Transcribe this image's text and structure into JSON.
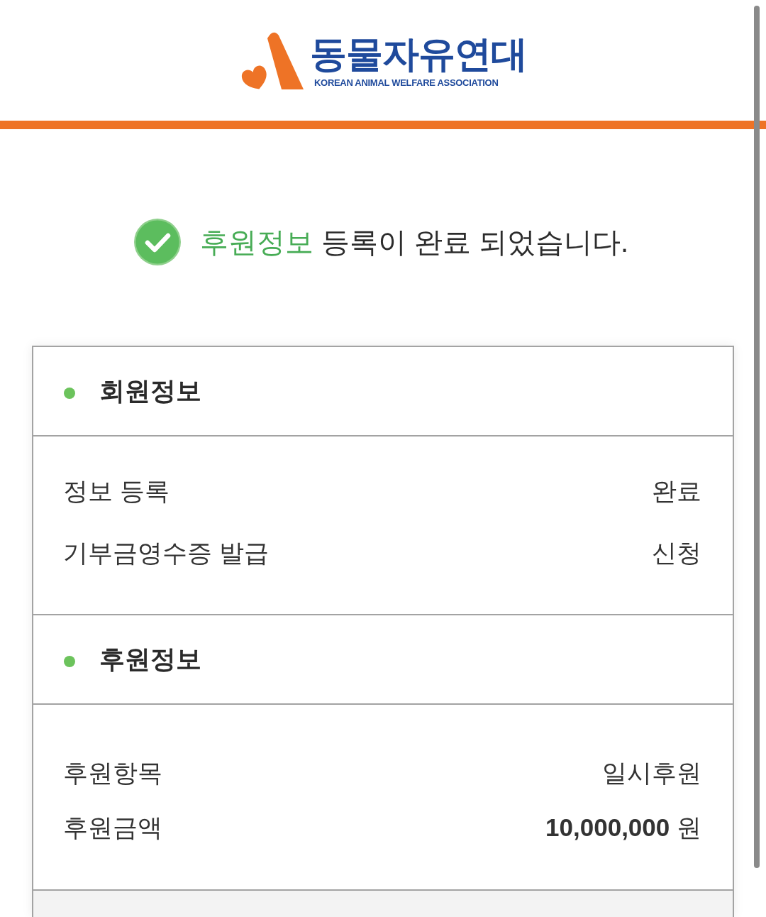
{
  "header": {
    "logo_title": "동물자유연대",
    "logo_subtitle": "KOREAN ANIMAL WELFARE ASSOCIATION"
  },
  "message": {
    "highlight": "후원정보",
    "text": "등록이 완료 되었습니다."
  },
  "sections": [
    {
      "title": "회원정보",
      "rows": [
        {
          "label": "정보 등록",
          "value": "완료"
        },
        {
          "label": "기부금영수증 발급",
          "value": "신청"
        }
      ]
    },
    {
      "title": "후원정보",
      "rows": [
        {
          "label": "후원항목",
          "value": "일시후원"
        },
        {
          "label": "후원금액",
          "value": "**10,000,000** 원"
        }
      ]
    }
  ]
}
